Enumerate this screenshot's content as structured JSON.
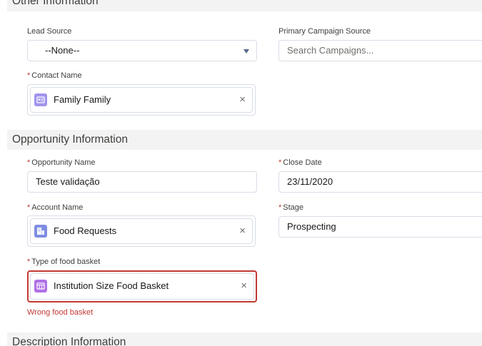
{
  "sections": {
    "other": "Other Information",
    "opportunity": "Opportunity Information",
    "description": "Description Information"
  },
  "other": {
    "lead_source": {
      "label": "Lead Source",
      "value": "--None--"
    },
    "primary_campaign": {
      "label": "Primary Campaign Source",
      "placeholder": "Search Campaigns..."
    },
    "contact": {
      "label": "Contact Name",
      "value": "Family Family",
      "icon": "contact-card-icon",
      "icon_color": "#a094ed"
    }
  },
  "opportunity": {
    "name": {
      "label": "Opportunity Name",
      "value": "Teste validação"
    },
    "close_date": {
      "label": "Close Date",
      "value": "23/11/2020"
    },
    "account": {
      "label": "Account Name",
      "value": "Food Requests",
      "icon": "account-icon",
      "icon_color": "#7f8de1"
    },
    "stage": {
      "label": "Stage",
      "value": "Prospecting"
    },
    "food_basket": {
      "label": "Type of food basket",
      "value": "Institution Size Food Basket",
      "icon": "custom-object-icon",
      "icon_color": "#b070e6",
      "error": "Wrong food basket"
    }
  },
  "required_marker": "*",
  "clear_glyph": "×",
  "colors": {
    "error": "#c23934",
    "section_bg": "#f3f3f3",
    "border": "#d8dde6"
  }
}
